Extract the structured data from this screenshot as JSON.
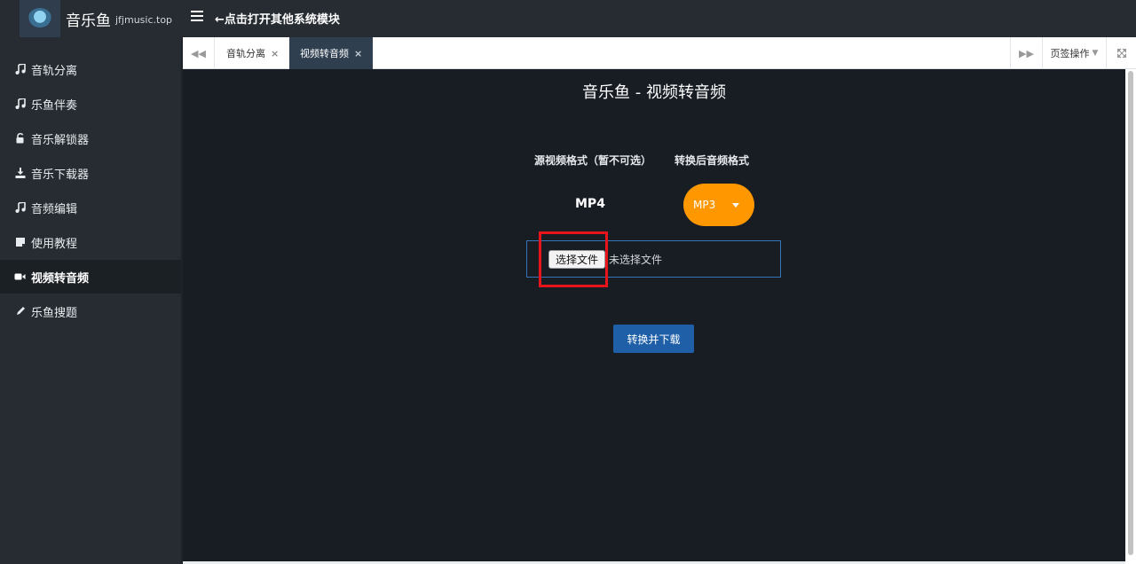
{
  "brand": {
    "name": "音乐鱼",
    "domain": "jfjmusic.top"
  },
  "topbar": {
    "message": "←点击打开其他系统模块"
  },
  "sidebar": {
    "items": [
      {
        "label": "音轨分离",
        "icon": "music-note-icon"
      },
      {
        "label": "乐鱼伴奏",
        "icon": "music-note-icon"
      },
      {
        "label": "音乐解锁器",
        "icon": "unlock-icon"
      },
      {
        "label": "音乐下载器",
        "icon": "download-icon"
      },
      {
        "label": "音频编辑",
        "icon": "music-note-icon"
      },
      {
        "label": "使用教程",
        "icon": "note-icon"
      },
      {
        "label": "视频转音频",
        "icon": "video-camera-icon",
        "active": true
      },
      {
        "label": "乐鱼搜题",
        "icon": "pencil-icon"
      }
    ]
  },
  "tabs": {
    "items": [
      {
        "label": "音轨分离",
        "active": false
      },
      {
        "label": "视频转音频",
        "active": true
      }
    ],
    "close_glyph": "×",
    "ops_label": "页签操作"
  },
  "main": {
    "title": "音乐鱼 - 视频转音频",
    "source_label": "源视频格式（暂不可选）",
    "target_label": "转换后音频格式",
    "source_format": "MP4",
    "target_format": "MP3",
    "file_button": "选择文件",
    "file_status": "未选择文件",
    "convert_button": "转换并下载"
  },
  "colors": {
    "accent_orange": "#ff9800",
    "primary_blue": "#1f5fa8",
    "highlight_red": "#e8141b",
    "sidebar_bg": "#262c32",
    "content_bg": "#181d24"
  }
}
